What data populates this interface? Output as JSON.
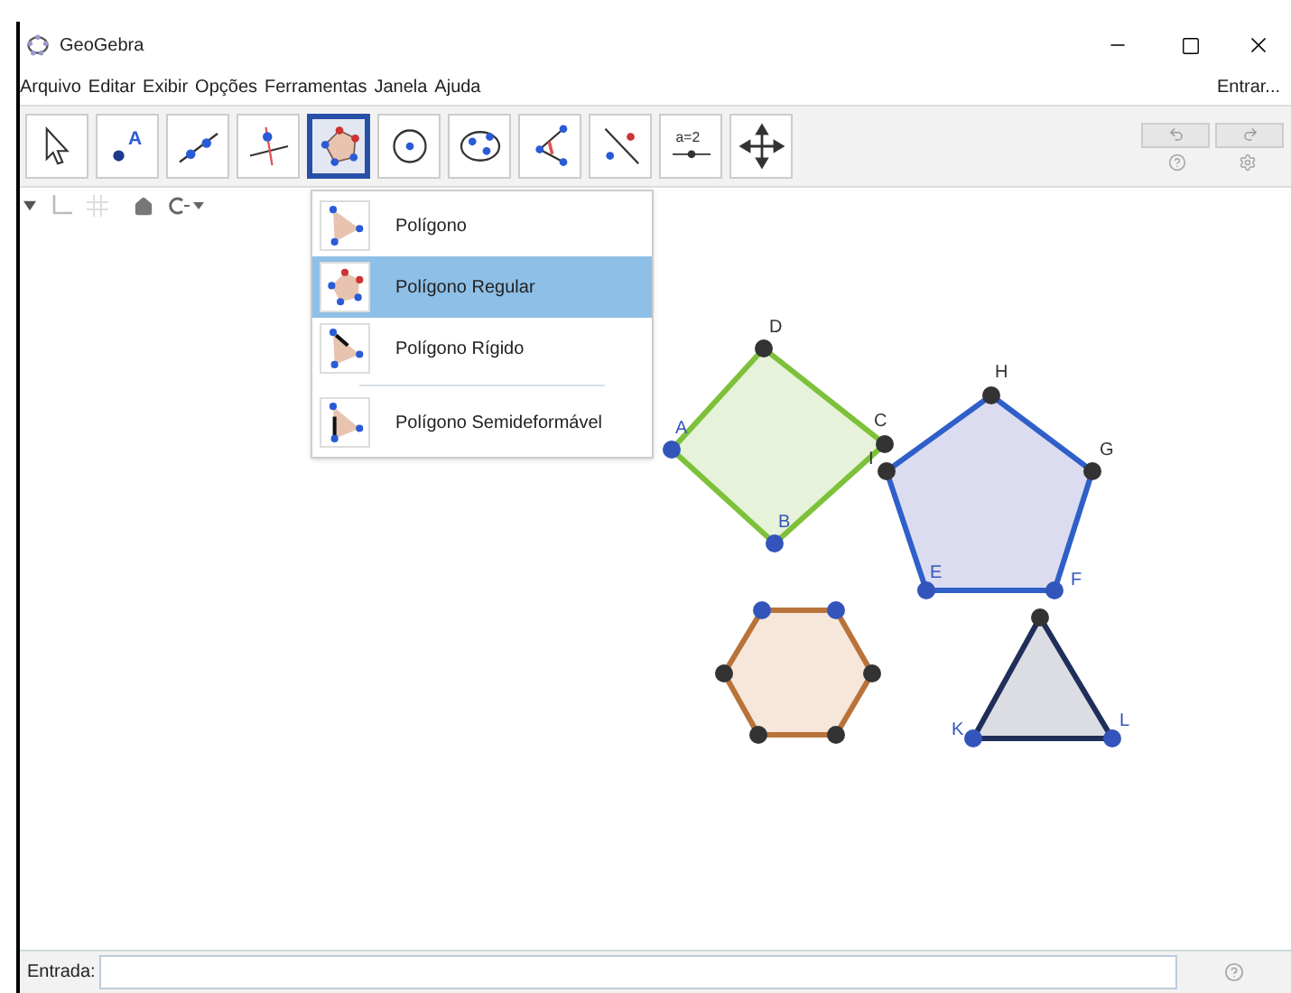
{
  "window": {
    "title": "GeoGebra"
  },
  "menu": [
    {
      "label": "Arquivo"
    },
    {
      "label": "Editar"
    },
    {
      "label": "Exibir"
    },
    {
      "label": "Opções"
    },
    {
      "label": "Ferramentas"
    },
    {
      "label": "Janela"
    },
    {
      "label": "Ajuda"
    }
  ],
  "sign_in": "Entrar...",
  "tools": [
    {
      "kind": "pointer",
      "selected": false
    },
    {
      "kind": "point",
      "text": "A",
      "selected": false
    },
    {
      "kind": "line",
      "selected": false
    },
    {
      "kind": "perpendicular",
      "selected": false
    },
    {
      "kind": "polygon",
      "selected": true
    },
    {
      "kind": "circle",
      "selected": false
    },
    {
      "kind": "conic",
      "selected": false
    },
    {
      "kind": "angle",
      "selected": false
    },
    {
      "kind": "reflect",
      "selected": false
    },
    {
      "kind": "slider",
      "text": "a=2",
      "selected": false
    },
    {
      "kind": "move",
      "selected": false
    }
  ],
  "dropdown": [
    {
      "kind": "polygon",
      "label": "Polígono",
      "selected": false
    },
    {
      "kind": "regular",
      "label": "Polígono Regular",
      "selected": true
    },
    {
      "kind": "rigid",
      "label": "Polígono Rígido",
      "selected": false
    },
    {
      "kind": "vector",
      "label": "Polígono Semideformável",
      "selected": false
    }
  ],
  "shapes": [
    {
      "kind": "square",
      "color": "#7dc13a",
      "points": [
        {
          "label": "A",
          "free": true
        },
        {
          "label": "B",
          "free": true
        },
        {
          "label": "C",
          "free": false
        },
        {
          "label": "D",
          "free": false
        }
      ]
    },
    {
      "kind": "pentagon",
      "color": "#2f5fc8",
      "points": [
        {
          "label": "E",
          "free": true
        },
        {
          "label": "F",
          "free": true
        },
        {
          "label": "G",
          "free": false
        },
        {
          "label": "H",
          "free": false
        },
        {
          "label": "I",
          "free": false
        }
      ]
    },
    {
      "kind": "hexagon",
      "color": "#b8733a",
      "points": [
        {
          "free": true
        },
        {
          "free": true
        },
        {
          "free": false
        },
        {
          "free": false
        },
        {
          "free": false
        },
        {
          "free": false
        }
      ]
    },
    {
      "kind": "triangle",
      "color": "#1f2f5a",
      "points": [
        {
          "label": "K",
          "free": true
        },
        {
          "label": "L",
          "free": true
        },
        {
          "free": false
        }
      ]
    }
  ],
  "input_bar": {
    "label": "Entrada:"
  }
}
